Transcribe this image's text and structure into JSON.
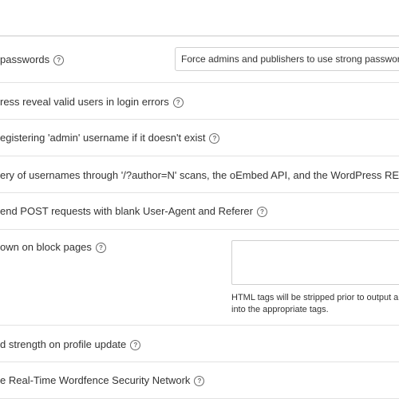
{
  "settings": {
    "rows": [
      {
        "label": "passwords",
        "has_help": true
      },
      {
        "label": "ress reveal valid users in login errors",
        "has_help": true
      },
      {
        "label": "egistering 'admin' username if it doesn't exist",
        "has_help": true
      },
      {
        "label": "ery of usernames through '/?author=N' scans, the oEmbed API, and the WordPress REST",
        "has_help": false
      },
      {
        "label": "end POST requests with blank User-Agent and Referer",
        "has_help": true
      },
      {
        "label": "own on block pages",
        "has_help": true
      },
      {
        "label": "d strength on profile update",
        "has_help": true
      },
      {
        "label": "e Real-Time Wordfence Security Network",
        "has_help": true
      }
    ],
    "password_select": {
      "value": "Force admins and publishers to use strong passwords"
    },
    "block_page_message": {
      "value": "",
      "note_line1": "HTML tags will be stripped prior to output ar",
      "note_line2": "into the appropriate tags."
    }
  },
  "icons": {
    "help": "help-circle-icon",
    "help_glyph": "?"
  },
  "colors": {
    "border": "#e2e2e2",
    "text": "#333333",
    "icon": "#6b6b6b"
  }
}
